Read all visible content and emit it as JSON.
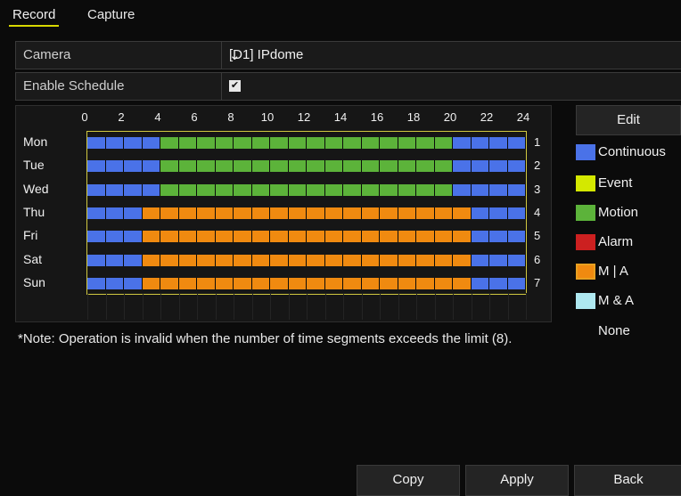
{
  "tabs": [
    {
      "label": "Record"
    },
    {
      "label": "Capture"
    }
  ],
  "camera": {
    "label": "Camera",
    "value": "[D1] IPdome"
  },
  "enable_schedule": {
    "label": "Enable Schedule",
    "checked": true
  },
  "hours": [
    "0",
    "2",
    "4",
    "6",
    "8",
    "10",
    "12",
    "14",
    "16",
    "18",
    "20",
    "22",
    "24"
  ],
  "days": [
    {
      "name": "Mon",
      "num": "1",
      "segments": [
        {
          "from": 0,
          "to": 4,
          "color": "#4a72e8"
        },
        {
          "from": 4,
          "to": 20,
          "color": "#5cb33a"
        },
        {
          "from": 20,
          "to": 24,
          "color": "#4a72e8"
        }
      ]
    },
    {
      "name": "Tue",
      "num": "2",
      "segments": [
        {
          "from": 0,
          "to": 4,
          "color": "#4a72e8"
        },
        {
          "from": 4,
          "to": 20,
          "color": "#5cb33a"
        },
        {
          "from": 20,
          "to": 24,
          "color": "#4a72e8"
        }
      ]
    },
    {
      "name": "Wed",
      "num": "3",
      "segments": [
        {
          "from": 0,
          "to": 4,
          "color": "#4a72e8"
        },
        {
          "from": 4,
          "to": 20,
          "color": "#5cb33a"
        },
        {
          "from": 20,
          "to": 24,
          "color": "#4a72e8"
        }
      ]
    },
    {
      "name": "Thu",
      "num": "4",
      "segments": [
        {
          "from": 0,
          "to": 3,
          "color": "#4a72e8"
        },
        {
          "from": 3,
          "to": 21,
          "color": "#f08a10"
        },
        {
          "from": 21,
          "to": 24,
          "color": "#4a72e8"
        }
      ]
    },
    {
      "name": "Fri",
      "num": "5",
      "segments": [
        {
          "from": 0,
          "to": 3,
          "color": "#4a72e8"
        },
        {
          "from": 3,
          "to": 21,
          "color": "#f08a10"
        },
        {
          "from": 21,
          "to": 24,
          "color": "#4a72e8"
        }
      ]
    },
    {
      "name": "Sat",
      "num": "6",
      "segments": [
        {
          "from": 0,
          "to": 3,
          "color": "#4a72e8"
        },
        {
          "from": 3,
          "to": 21,
          "color": "#f08a10"
        },
        {
          "from": 21,
          "to": 24,
          "color": "#4a72e8"
        }
      ]
    },
    {
      "name": "Sun",
      "num": "7",
      "segments": [
        {
          "from": 0,
          "to": 3,
          "color": "#4a72e8"
        },
        {
          "from": 3,
          "to": 21,
          "color": "#f08a10"
        },
        {
          "from": 21,
          "to": 24,
          "color": "#4a72e8"
        }
      ]
    }
  ],
  "legend": {
    "edit_label": "Edit",
    "items": [
      {
        "label": "Continuous",
        "color": "#4a72e8"
      },
      {
        "label": "Event",
        "color": "#d4e800"
      },
      {
        "label": "Motion",
        "color": "#5cb33a"
      },
      {
        "label": "Alarm",
        "color": "#cc2020"
      },
      {
        "label": "M | A",
        "color": "#f08a10"
      },
      {
        "label": "M & A",
        "color": "#aee8f0"
      },
      {
        "label": "None",
        "color": ""
      }
    ]
  },
  "note": "*Note: Operation is invalid when the number of time segments exceeds the limit (8).",
  "buttons": {
    "copy": "Copy",
    "apply": "Apply",
    "back": "Back"
  }
}
